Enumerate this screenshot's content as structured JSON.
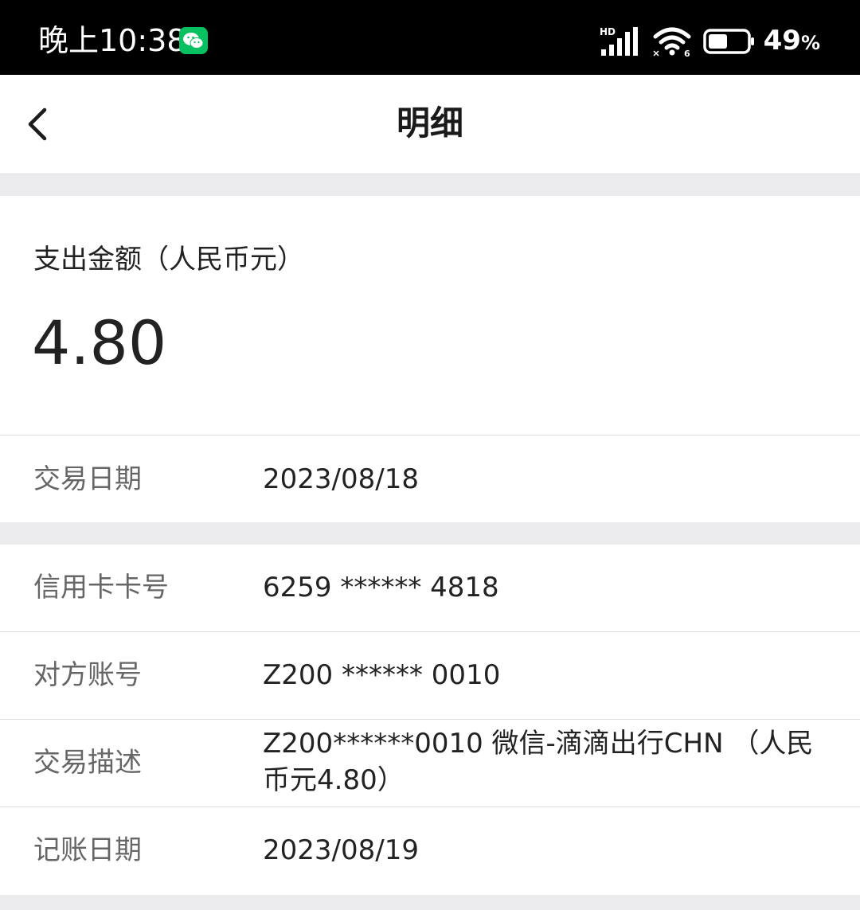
{
  "status_bar": {
    "time": "晚上10:38",
    "network_type": "HD",
    "battery_percent": "49",
    "battery_unit": "%",
    "battery_level": 0.49,
    "icons": [
      "wechat-icon",
      "signal-icon",
      "wifi-icon",
      "battery-icon"
    ]
  },
  "nav": {
    "title": "明细",
    "back_icon": "chevron-left-icon"
  },
  "amount": {
    "label": "支出金额（人民币元）",
    "value": "4.80"
  },
  "details": {
    "transaction_date": {
      "label": "交易日期",
      "value": "2023/08/18"
    },
    "card_number": {
      "label": "信用卡卡号",
      "value": "6259 ****** 4818"
    },
    "counterparty_account": {
      "label": "对方账号",
      "value": "Z200 ****** 0010"
    },
    "description": {
      "label": "交易描述",
      "value": "Z200******0010 微信-滴滴出行CHN （人民币元4.80）"
    },
    "posting_date": {
      "label": "记账日期",
      "value": "2023/08/19"
    }
  },
  "colors": {
    "background": "#ececef",
    "card": "#ffffff",
    "status_bar": "#000000",
    "wechat_green": "#07c160",
    "label_text": "#666666",
    "value_text": "#222222"
  }
}
